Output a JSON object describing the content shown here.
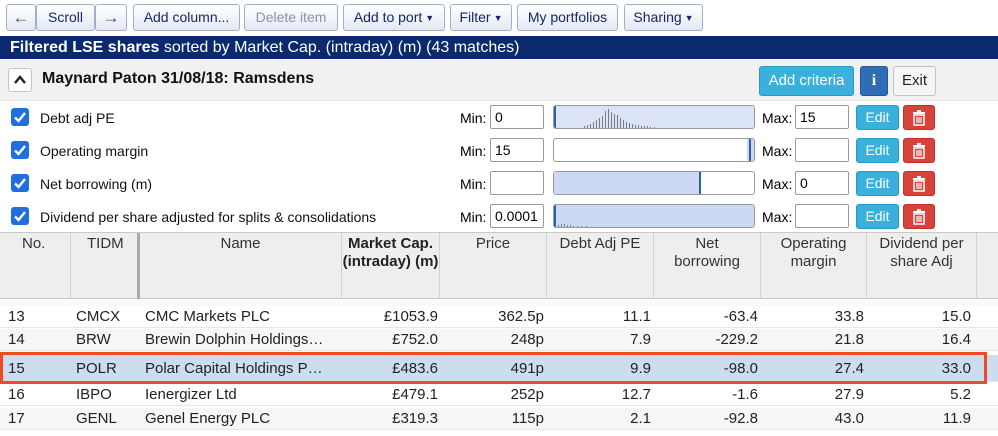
{
  "toolbar": {
    "back_icon": "left-arrow-icon",
    "scroll_label": "Scroll",
    "forward_icon": "right-arrow-icon",
    "add_column_label": "Add column...",
    "delete_item_label": "Delete item",
    "add_to_port_label": "Add to port",
    "filter_label": "Filter",
    "my_portfolios_label": "My portfolios",
    "sharing_label": "Sharing"
  },
  "title_bar": {
    "bold": "Filtered LSE shares",
    "rest": " sorted by Market Cap. (intraday) (m) (43 matches)"
  },
  "criteria": {
    "screen_name": "Maynard Paton 31/08/18: Ramsdens",
    "add_criteria_label": "Add criteria",
    "info_label": "i",
    "exit_label": "Exit",
    "min_label": "Min:",
    "max_label": "Max:",
    "edit_label": "Edit",
    "rows": [
      {
        "label": "Debt adj PE",
        "min": "0",
        "max": "15",
        "checked": true
      },
      {
        "label": "Operating margin",
        "min": "15",
        "max": "",
        "checked": true
      },
      {
        "label": "Net borrowing (m)",
        "min": "",
        "max": "0",
        "checked": true
      },
      {
        "label": "Dividend per share adjusted for splits & consolidations",
        "min": "0.0001",
        "max": "",
        "checked": true
      }
    ]
  },
  "table": {
    "columns": [
      "No.",
      "TIDM",
      "Name",
      "Market Cap. (intraday) (m)",
      "Price",
      "Debt Adj PE",
      "Net borrowing",
      "Operating margin",
      "Dividend per share Adj"
    ],
    "rows": [
      {
        "no": "13",
        "tidm": "CMCX",
        "name": "CMC Markets PLC",
        "mcap": "£1053.9",
        "price": "362.5p",
        "pe": "11.1",
        "net": "-63.4",
        "margin": "33.8",
        "div": "15.0"
      },
      {
        "no": "14",
        "tidm": "BRW",
        "name": "Brewin Dolphin Holdings…",
        "mcap": "£752.0",
        "price": "248p",
        "pe": "7.9",
        "net": "-229.2",
        "margin": "21.8",
        "div": "16.4"
      },
      {
        "no": "15",
        "tidm": "POLR",
        "name": "Polar Capital Holdings P…",
        "mcap": "£483.6",
        "price": "491p",
        "pe": "9.9",
        "net": "-98.0",
        "margin": "27.4",
        "div": "33.0"
      },
      {
        "no": "16",
        "tidm": "IBPO",
        "name": "Ienergizer Ltd",
        "mcap": "£479.1",
        "price": "252p",
        "pe": "12.7",
        "net": "-1.6",
        "margin": "27.9",
        "div": "5.2"
      },
      {
        "no": "17",
        "tidm": "GENL",
        "name": "Genel Energy PLC",
        "mcap": "£319.3",
        "price": "115p",
        "pe": "2.1",
        "net": "-92.8",
        "margin": "43.0",
        "div": "11.9"
      }
    ]
  }
}
